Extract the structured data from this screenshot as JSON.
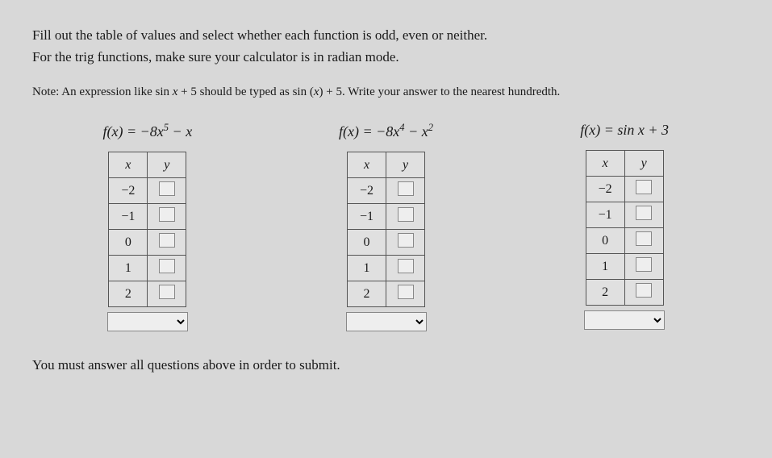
{
  "instructions_line1": "Fill out the table of values and select whether each function is odd, even or neither.",
  "instructions_line2": "For the trig functions, make sure your calculator is in radian mode.",
  "note_prefix": "Note: An expression like sin ",
  "note_var1": "x",
  "note_mid1": " + 5 should be typed as sin (",
  "note_var2": "x",
  "note_mid2": ") + 5. Write your answer to the nearest hundredth.",
  "headers": {
    "x": "x",
    "y": "y"
  },
  "xvalues": [
    "−2",
    "−1",
    "0",
    "1",
    "2"
  ],
  "problems": {
    "p1": {
      "lhs": "f(x) = ",
      "rhs_a": "−8x",
      "rhs_exp": "5",
      "rhs_b": " − x"
    },
    "p2": {
      "lhs": "f(x) = ",
      "rhs_a": "−8x",
      "rhs_expA": "4",
      "rhs_mid": " − x",
      "rhs_expB": "2"
    },
    "p3": {
      "lhs": "f(x) = ",
      "rhs": "sin x + 3"
    }
  },
  "footer": "You must answer all questions above in order to submit."
}
